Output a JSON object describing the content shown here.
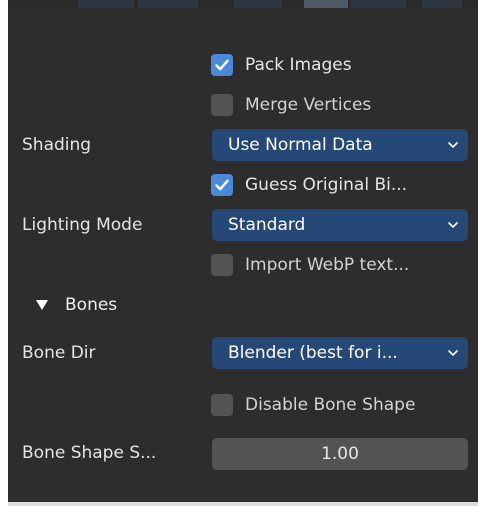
{
  "options": {
    "pack_images": {
      "label": "Pack Images",
      "checked": true
    },
    "merge_vertices": {
      "label": "Merge Vertices",
      "checked": false
    },
    "shading": {
      "label": "Shading",
      "value": "Use Normal Data"
    },
    "guess_original_bind": {
      "label": "Guess Original Bi...",
      "checked": true
    },
    "lighting_mode": {
      "label": "Lighting Mode",
      "value": "Standard"
    },
    "import_webp": {
      "label": "Import WebP text...",
      "checked": false
    }
  },
  "bones": {
    "section_label": "Bones",
    "bone_dir": {
      "label": "Bone Dir",
      "value": "Blender (best for i..."
    },
    "disable_bone_shape": {
      "label": "Disable Bone Shape",
      "checked": false
    },
    "bone_shape_scale": {
      "label": "Bone Shape S...",
      "value": "1.00"
    }
  },
  "colors": {
    "panel_bg": "#2d2d2d",
    "dropdown_bg": "#264877",
    "checkbox_checked": "#4b89d9",
    "checkbox_unchecked": "#545454",
    "field_bg": "#545454"
  },
  "icons": {
    "checkmark": "checkmark-icon",
    "chevron": "chevron-down-icon",
    "disclosure": "triangle-down-icon"
  }
}
